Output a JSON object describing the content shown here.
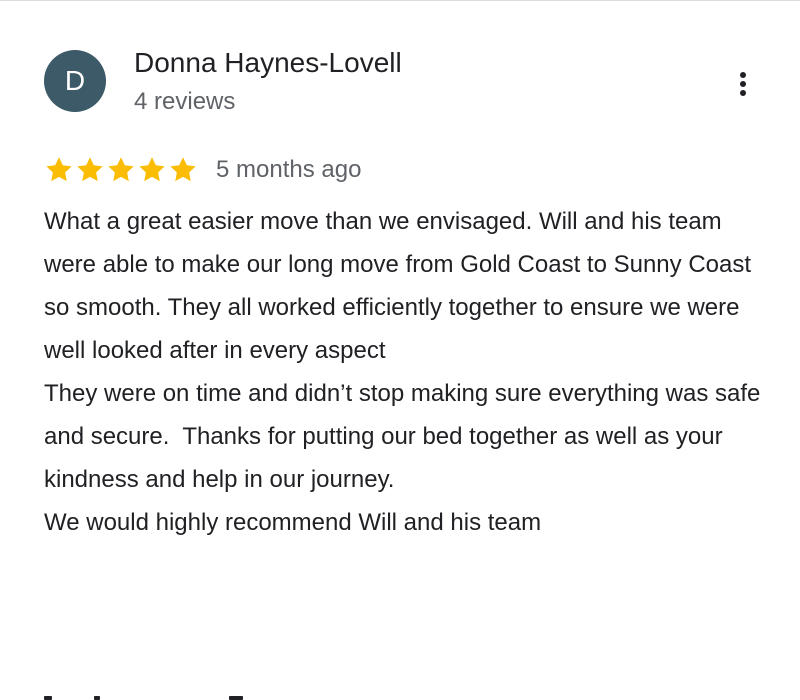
{
  "review": {
    "avatar_letter": "D",
    "reviewer_name": "Donna Haynes-Lovell",
    "review_count": "4 reviews",
    "rating": 5,
    "rating_max": 5,
    "time_ago": "5 months ago",
    "text": "What a great easier move than we envisaged. Will and his team were able to make our long move from Gold Coast to Sunny Coast so smooth. They all worked efficiently together to ensure we were well looked after in every aspect\nThey were on time and didn’t stop making sure everything was safe and secure.  Thanks for putting our bed together as well as your kindness and help in our journey.\nWe would highly recommend Will and his team"
  },
  "icons": {
    "more": "more-vert-icon",
    "star": "star-icon"
  },
  "colors": {
    "avatar_bg": "#3c5a68",
    "star": "#fbbc04",
    "secondary_text": "#5f6368",
    "primary_text": "#202124"
  }
}
